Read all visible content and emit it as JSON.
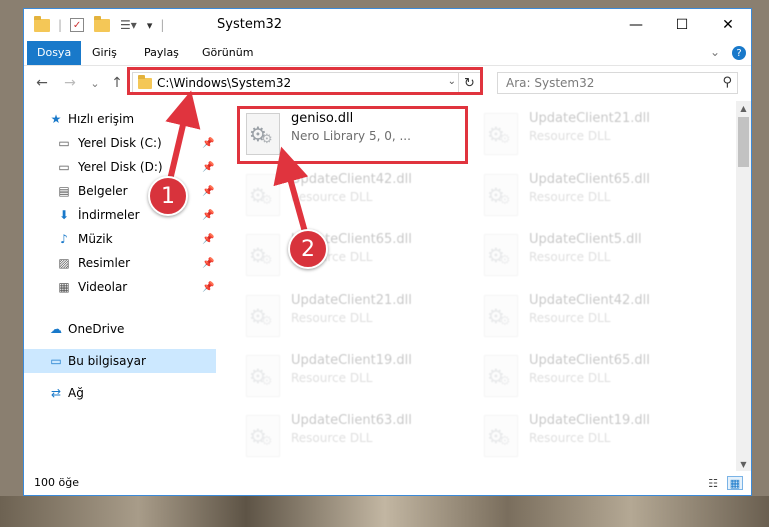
{
  "window": {
    "title": "System32",
    "minimize_icon": "—",
    "maximize_icon": "☐",
    "close_icon": "✕",
    "help_icon": "?",
    "expand_ribbon_icon": "⌄"
  },
  "ribbon": {
    "tabs": [
      "Dosya",
      "Giriş",
      "Paylaş",
      "Görünüm"
    ]
  },
  "address": {
    "back_icon": "←",
    "forward_icon": "→",
    "recent_icon": "⌄",
    "up_icon": "↑",
    "path": "C:\\Windows\\System32",
    "dropdown_icon": "⌄",
    "refresh_icon": "↻",
    "search_placeholder": "Ara: System32",
    "search_icon": "⚲"
  },
  "navpane": {
    "items": [
      {
        "label": "Hızlı erişim",
        "icon": "★"
      },
      {
        "label": "Yerel Disk (C:)",
        "icon": "▭"
      },
      {
        "label": "Yerel Disk (D:)",
        "icon": "▭"
      },
      {
        "label": "Belgeler",
        "icon": "▤"
      },
      {
        "label": "İndirmeler",
        "icon": "⬇"
      },
      {
        "label": "Müzik",
        "icon": "♪"
      },
      {
        "label": "Resimler",
        "icon": "▨"
      },
      {
        "label": "Videolar",
        "icon": "▦"
      },
      {
        "label": "OneDrive",
        "icon": "☁"
      },
      {
        "label": "Bu bilgisayar",
        "icon": "▭"
      },
      {
        "label": "Ağ",
        "icon": "⇄"
      }
    ],
    "pin_icon": "📌"
  },
  "files": [
    {
      "name": "geniso.dll",
      "desc": "Nero Library 5, 0, ..."
    },
    {
      "name": "UpdateClient21.dll",
      "desc": "Resource DLL"
    },
    {
      "name": "UpdateClient42.dll",
      "desc": "Resource DLL"
    },
    {
      "name": "UpdateClient65.dll",
      "desc": "Resource DLL"
    },
    {
      "name": "UpdateClient65.dll",
      "desc": "Resource DLL"
    },
    {
      "name": "UpdateClient5.dll",
      "desc": "Resource DLL"
    },
    {
      "name": "UpdateClient21.dll",
      "desc": "Resource DLL"
    },
    {
      "name": "UpdateClient42.dll",
      "desc": "Resource DLL"
    },
    {
      "name": "UpdateClient19.dll",
      "desc": "Resource DLL"
    },
    {
      "name": "UpdateClient65.dll",
      "desc": "Resource DLL"
    },
    {
      "name": "UpdateClient63.dll",
      "desc": "Resource DLL"
    },
    {
      "name": "UpdateClient19.dll",
      "desc": "Resource DLL"
    }
  ],
  "statusbar": {
    "item_count": "100 öğe",
    "details_view_icon": "☷",
    "large_icons_view_icon": "▦"
  },
  "annotations": {
    "step1": "1",
    "step2": "2",
    "color": "#e0343e"
  }
}
